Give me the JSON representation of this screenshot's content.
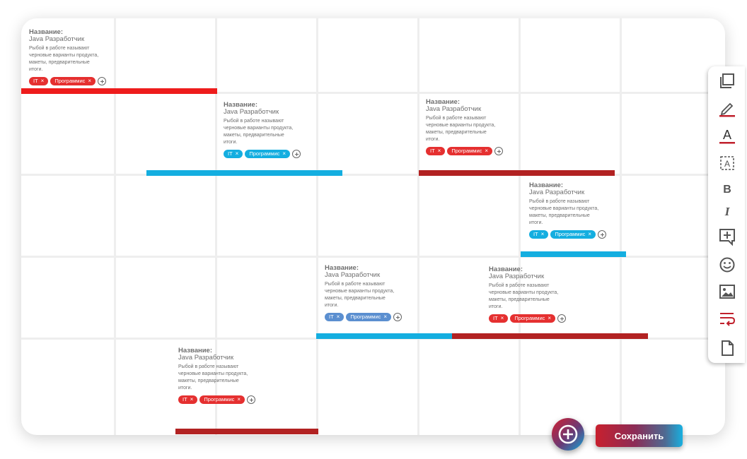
{
  "card_caption": "Название:",
  "cards": [
    {
      "title": "Java Разработчик",
      "description": "Рыбой в работе называют черновые варианты продукта, макеты, предварительные итоги.",
      "tags": [
        "IT",
        "Программис"
      ]
    },
    {
      "title": "Java Разработчик",
      "description": "Рыбой в работе называют черновые варианты продукта, макеты, предварительные итоги.",
      "tags": [
        "IT",
        "Программис"
      ]
    },
    {
      "title": "Java Разработчик",
      "description": "Рыбой в работе называют черновые варианты продукта, макеты, предварительные итоги.",
      "tags": [
        "IT",
        "Программис"
      ]
    },
    {
      "title": "Java Разработчик",
      "description": "Рыбой в работе называют черновые варианты продукта, макеты, предварительные итоги.",
      "tags": [
        "IT",
        "Программис"
      ]
    },
    {
      "title": "Java Разработчик",
      "description": "Рыбой в работе называют черновые варианты продукта, макеты, предварительные итоги.",
      "tags": [
        "IT",
        "Программис"
      ]
    },
    {
      "title": "Java Разработчик",
      "description": "Рыбой в работе называют черновые варианты продукта, макеты, предварительные итоги.",
      "tags": [
        "IT",
        "Программис"
      ]
    },
    {
      "title": "Java Разработчик",
      "description": "Рыбой в работе называют черновые варианты продукта, макеты, предварительные итоги.",
      "tags": [
        "IT",
        "Программис"
      ]
    }
  ],
  "tag_remove_glyph": "×",
  "toolbar_icons": [
    "copy-icon",
    "pencil-icon",
    "text-color-icon",
    "text-box-icon",
    "bold-icon",
    "italic-icon",
    "add-comment-icon",
    "emoji-icon",
    "image-icon",
    "wrap-icon",
    "file-icon"
  ],
  "toolbar_labels": {
    "text_color": "A",
    "bold": "B",
    "italic": "I"
  },
  "colors": {
    "red": "#e53030",
    "dark_red": "#b22222",
    "blue": "#14aee0",
    "slate": "#5b8fd0",
    "accent": "#c0202c"
  },
  "save_label": "Сохранить"
}
